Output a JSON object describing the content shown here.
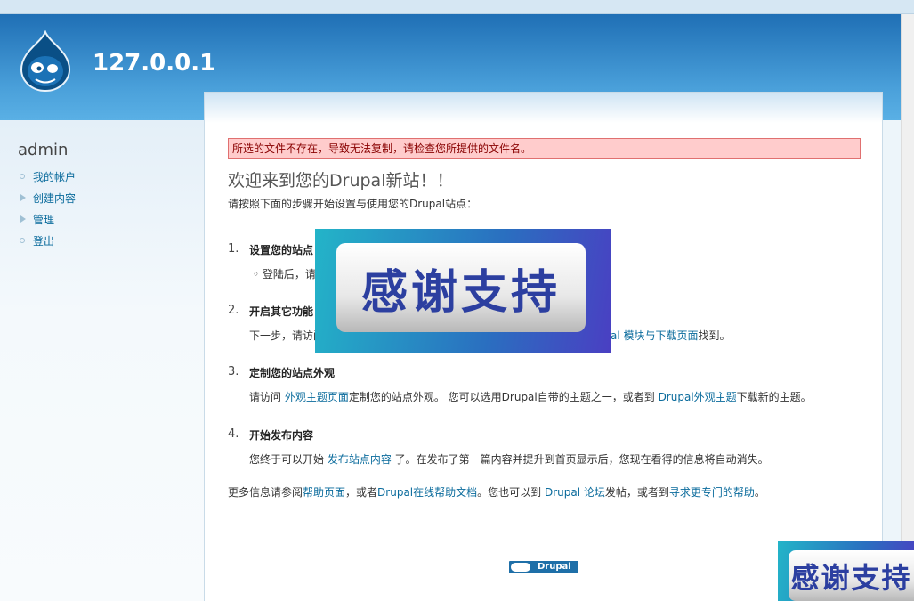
{
  "site": {
    "name": "127.0.0.1"
  },
  "sidebar": {
    "user": "admin",
    "items": [
      {
        "label": "我的帐户"
      },
      {
        "label": "创建内容"
      },
      {
        "label": "管理"
      },
      {
        "label": "登出"
      }
    ]
  },
  "messages": {
    "error": "所选的文件不存在，导致无法复制，请检查您所提供的文件名。"
  },
  "main": {
    "title": "欢迎来到您的Drupal新站！！",
    "intro": "请按照下面的步骤开始设置与使用您的Drupal站点：",
    "steps": [
      {
        "num": "1.",
        "title": "设置您的站点",
        "desc": "◦  登陆后，请"
      },
      {
        "num": "2.",
        "title": "开启其它功能",
        "desc_pre": "下一步，请访问",
        "desc_link": "al 模块与下载页面",
        "desc_post": "找到。"
      },
      {
        "num": "3.",
        "title": "定制您的站点外观",
        "desc_pre": "请访问 ",
        "link1": "外观主题页面",
        "desc_mid": "定制您的站点外观。 您可以选用Drupal自带的主题之一，或者到 ",
        "link2": "Drupal外观主题",
        "desc_post": "下载新的主题。"
      },
      {
        "num": "4.",
        "title": "开始发布内容",
        "desc_pre": "您终于可以开始 ",
        "link1": "发布站点内容",
        "desc_post": " 了。在发布了第一篇内容并提升到首页显示后，您现在看得的信息将自动消失。"
      }
    ],
    "more": {
      "pre": "更多信息请参阅",
      "link1": "帮助页面",
      "mid1": "，或者",
      "link2": "Drupal在线帮助文档",
      "mid2": "。您也可以到 ",
      "link3": "Drupal 论坛",
      "mid3": "发帖，或者到",
      "link4": "寻求更专门的帮助",
      "post": "。"
    }
  },
  "footer": {
    "powered": "Drupal"
  },
  "watermarks": [
    {
      "text": "感谢支持"
    },
    {
      "text": "感谢支持"
    }
  ],
  "colors": {
    "header": "#2f86c8",
    "link": "#0a6b9c",
    "error_bg": "#ffcccc"
  }
}
